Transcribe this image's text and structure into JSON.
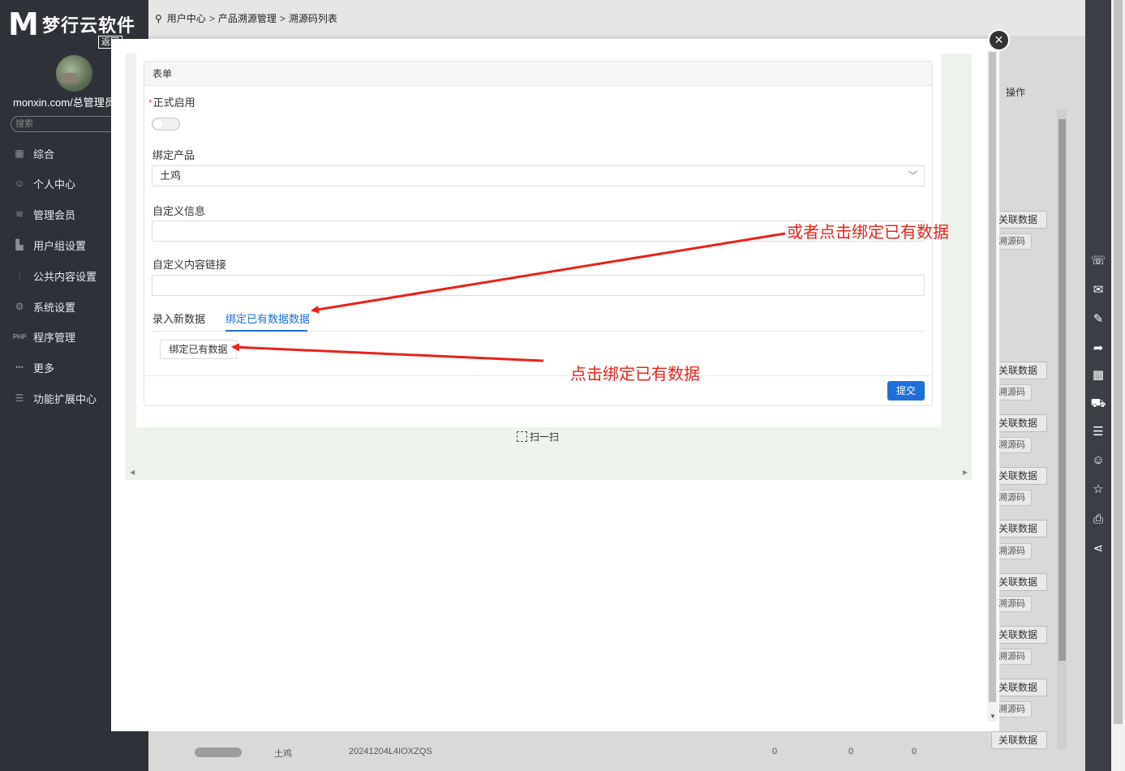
{
  "brand": {
    "logo_mark": "M",
    "name": "梦行云软件",
    "back_label": "返回"
  },
  "user": {
    "name": "monxin.com/总管理员"
  },
  "sidebar": {
    "search_placeholder": "搜索",
    "items": [
      {
        "label": "综合",
        "icon": "grid-icon",
        "glyph": "▦"
      },
      {
        "label": "个人中心",
        "icon": "user-icon",
        "glyph": "☺"
      },
      {
        "label": "管理会员",
        "icon": "layers-icon",
        "glyph": "≋"
      },
      {
        "label": "用户组设置",
        "icon": "bar-chart-icon",
        "glyph": "▙"
      },
      {
        "label": "公共内容设置",
        "icon": "tools-icon",
        "glyph": "⫶"
      },
      {
        "label": "系统设置",
        "icon": "gear-icon",
        "glyph": "⚙"
      },
      {
        "label": "程序管理",
        "icon": "php-icon",
        "glyph": "PHP"
      },
      {
        "label": "更多",
        "icon": "more-dots-icon",
        "glyph": "•••"
      },
      {
        "label": "功能扩展中心",
        "icon": "menu-icon",
        "glyph": "☰"
      }
    ]
  },
  "breadcrumb": {
    "items": [
      "用户中心",
      "产品溯源管理",
      "溯源码列表"
    ],
    "separator": ">"
  },
  "background_table": {
    "op_header": "操作",
    "row_button": "关联数据",
    "row_button2": "溯源码",
    "bottom_row": {
      "name": "土鸡",
      "code": "20241204L4IOXZQS",
      "c1": "0",
      "c2": "0",
      "c3": "0"
    }
  },
  "modal": {
    "card_title": "表单",
    "fields": {
      "enabled_label": "正式启用",
      "enabled_required": "*",
      "product_label": "绑定产品",
      "product_value": "土鸡",
      "custom_info_label": "自定义信息",
      "custom_info_value": "",
      "custom_link_label": "自定义内容链接",
      "custom_link_value": ""
    },
    "tabs": [
      "录入新数据",
      "绑定已有数据数据"
    ],
    "active_tab": 1,
    "bind_button": "绑定已有数据",
    "submit": "提交",
    "scan": "扫一扫",
    "toggle_on": false
  },
  "annotations": {
    "top": "或者点击绑定已有数据",
    "bottom": "点击绑定已有数据",
    "color": "#e8231b"
  },
  "right_rail_icons": [
    "wechat-icon",
    "message-icon",
    "edit-icon",
    "share-arrow-icon",
    "qrcode-icon",
    "cart-icon",
    "list-icon",
    "user-icon",
    "star-icon",
    "print-icon",
    "share-icon"
  ]
}
